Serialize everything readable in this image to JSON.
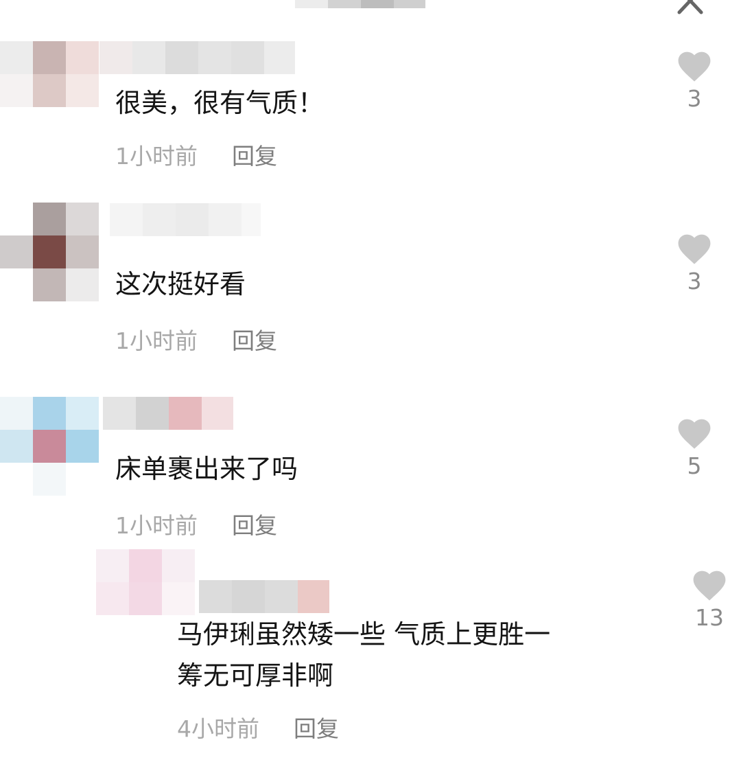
{
  "colors": {
    "text": "#141414",
    "meta": "#a8a8a8",
    "reply": "#7e7e7e",
    "heart": "#c8c8c8"
  },
  "icons": {
    "close": "close-icon",
    "like": "heart-icon"
  },
  "comments": [
    {
      "text": "很美，很有气质！",
      "time": "1小时前",
      "reply": "回复",
      "likes": "3"
    },
    {
      "text": "这次挺好看",
      "time": "1小时前",
      "reply": "回复",
      "likes": "3"
    },
    {
      "text": "床单裹出来了吗",
      "time": "1小时前",
      "reply": "回复",
      "likes": "5"
    },
    {
      "text_line1": "马伊琍虽然矮一些 气质上更胜一",
      "text_line2": "筹无可厚非啊",
      "time": "4小时前",
      "reply": "回复",
      "likes": "13"
    }
  ]
}
